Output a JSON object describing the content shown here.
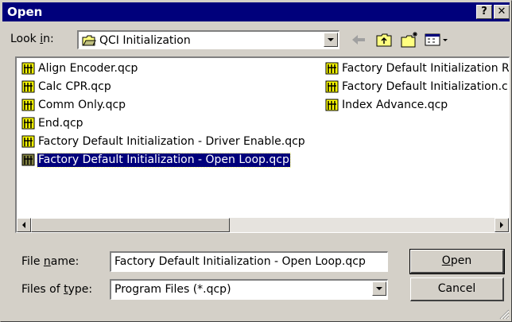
{
  "window": {
    "title": "Open",
    "help_glyph": "?",
    "close_glyph": "✕"
  },
  "lookin": {
    "label_pre": "Look ",
    "label_key": "i",
    "label_post": "n:",
    "value": "QCI Initialization"
  },
  "toolbar": {
    "icons": [
      "back-arrow-icon",
      "up-folder-icon",
      "new-folder-icon",
      "view-menu-icon"
    ]
  },
  "files": [
    {
      "name": "Align Encoder.qcp",
      "icon": "qcp-file-icon",
      "selected": false
    },
    {
      "name": "Calc CPR.qcp",
      "icon": "qcp-file-icon",
      "selected": false
    },
    {
      "name": "Comm Only.qcp",
      "icon": "qcp-file-icon",
      "selected": false
    },
    {
      "name": "End.qcp",
      "icon": "qcp-file-icon",
      "selected": false
    },
    {
      "name": "Factory Default Initialization - Driver Enable.qcp",
      "icon": "qcp-file-icon",
      "selected": false
    },
    {
      "name": "Factory Default Initialization - Open Loop.qcp",
      "icon": "qcp-file-icon",
      "selected": true
    },
    {
      "name": "Factory Default Initialization R",
      "icon": "qcp-file-icon",
      "selected": false
    },
    {
      "name": "Factory Default Initialization.c",
      "icon": "qcp-file-icon",
      "selected": false
    },
    {
      "name": "Index Advance.qcp",
      "icon": "qcp-file-icon",
      "selected": false
    }
  ],
  "filename": {
    "label_pre": "File ",
    "label_key": "n",
    "label_post": "ame:",
    "value": "Factory Default Initialization - Open Loop.qcp"
  },
  "filetype": {
    "label_pre": "Files of ",
    "label_key": "t",
    "label_post": "ype:",
    "value": "Program Files (*.qcp)"
  },
  "buttons": {
    "open_key": "O",
    "open_rest": "pen",
    "cancel": "Cancel"
  }
}
